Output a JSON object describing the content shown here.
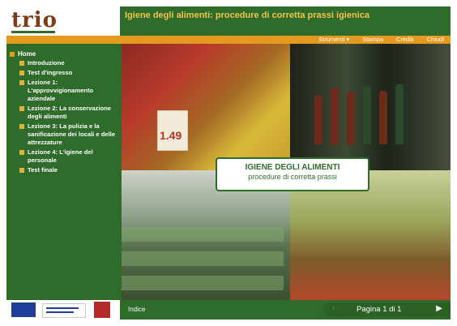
{
  "brand": {
    "logo": "trio"
  },
  "header": {
    "title": "Igiene degli alimenti: procedure di corretta prassi igienica"
  },
  "toolbar": {
    "items": [
      {
        "label": "Strumenti ▾"
      },
      {
        "label": "Stampa"
      },
      {
        "label": "Crediti"
      },
      {
        "label": "Chiudi"
      }
    ]
  },
  "sidebar": {
    "home": "Home",
    "items": [
      {
        "label": "Introduzione"
      },
      {
        "label": "Test d'ingresso"
      },
      {
        "label": "Lezione 1: L'approvvigionamento aziendale"
      },
      {
        "label": "Lezione 2: La conservazione degli alimenti"
      },
      {
        "label": "Lezione 3: La pulizia e la sanificazione dei locali e delle attrezzature"
      },
      {
        "label": "Lezione 4: L'igiene del personale"
      },
      {
        "label": "Test finale"
      }
    ]
  },
  "hero": {
    "card_title": "IGIENE DEGLI ALIMENTI",
    "card_subtitle": "procedure di corretta prassi",
    "price_tag": "1.49"
  },
  "footer": {
    "indice": "Indice",
    "page_label": "Pagina 1 di 1",
    "prev_icon": "‹",
    "next_icon": "▶"
  },
  "colors": {
    "primary_green": "#2f6b2a",
    "toolbar_orange": "#e39a1e",
    "title_yellow": "#f2c44a",
    "logo_brown": "#7a3d17"
  }
}
